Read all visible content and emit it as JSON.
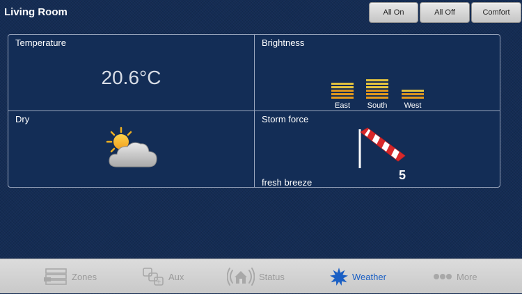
{
  "header": {
    "title": "Living Room",
    "buttons": [
      {
        "label": "All On"
      },
      {
        "label": "All Off"
      },
      {
        "label": "Comfort"
      }
    ]
  },
  "tiles": {
    "temperature": {
      "label": "Temperature",
      "value": "20.6°C"
    },
    "brightness": {
      "label": "Brightness",
      "sensors": [
        {
          "name": "East",
          "level_bars": 5
        },
        {
          "name": "South",
          "level_bars": 6
        },
        {
          "name": "West",
          "level_bars": 3
        }
      ]
    },
    "dry": {
      "label": "Dry",
      "icon": "partly-cloudy-icon"
    },
    "storm": {
      "label": "Storm force",
      "force": "5",
      "description": "fresh breeze",
      "icon": "windsock-icon"
    }
  },
  "tabs": [
    {
      "label": "Zones",
      "icon": "zones-icon",
      "active": false
    },
    {
      "label": "Aux",
      "icon": "aux-icon",
      "active": false
    },
    {
      "label": "Status",
      "icon": "status-icon",
      "active": false
    },
    {
      "label": "Weather",
      "icon": "weather-icon",
      "active": true
    },
    {
      "label": "More",
      "icon": "more-icon",
      "active": false
    }
  ],
  "colors": {
    "background": "#142c54",
    "active_tab": "#1a5fc4",
    "bar_top": "#f7d23c",
    "bar_bottom": "#e59a1c",
    "windsock_red": "#d8282a"
  }
}
